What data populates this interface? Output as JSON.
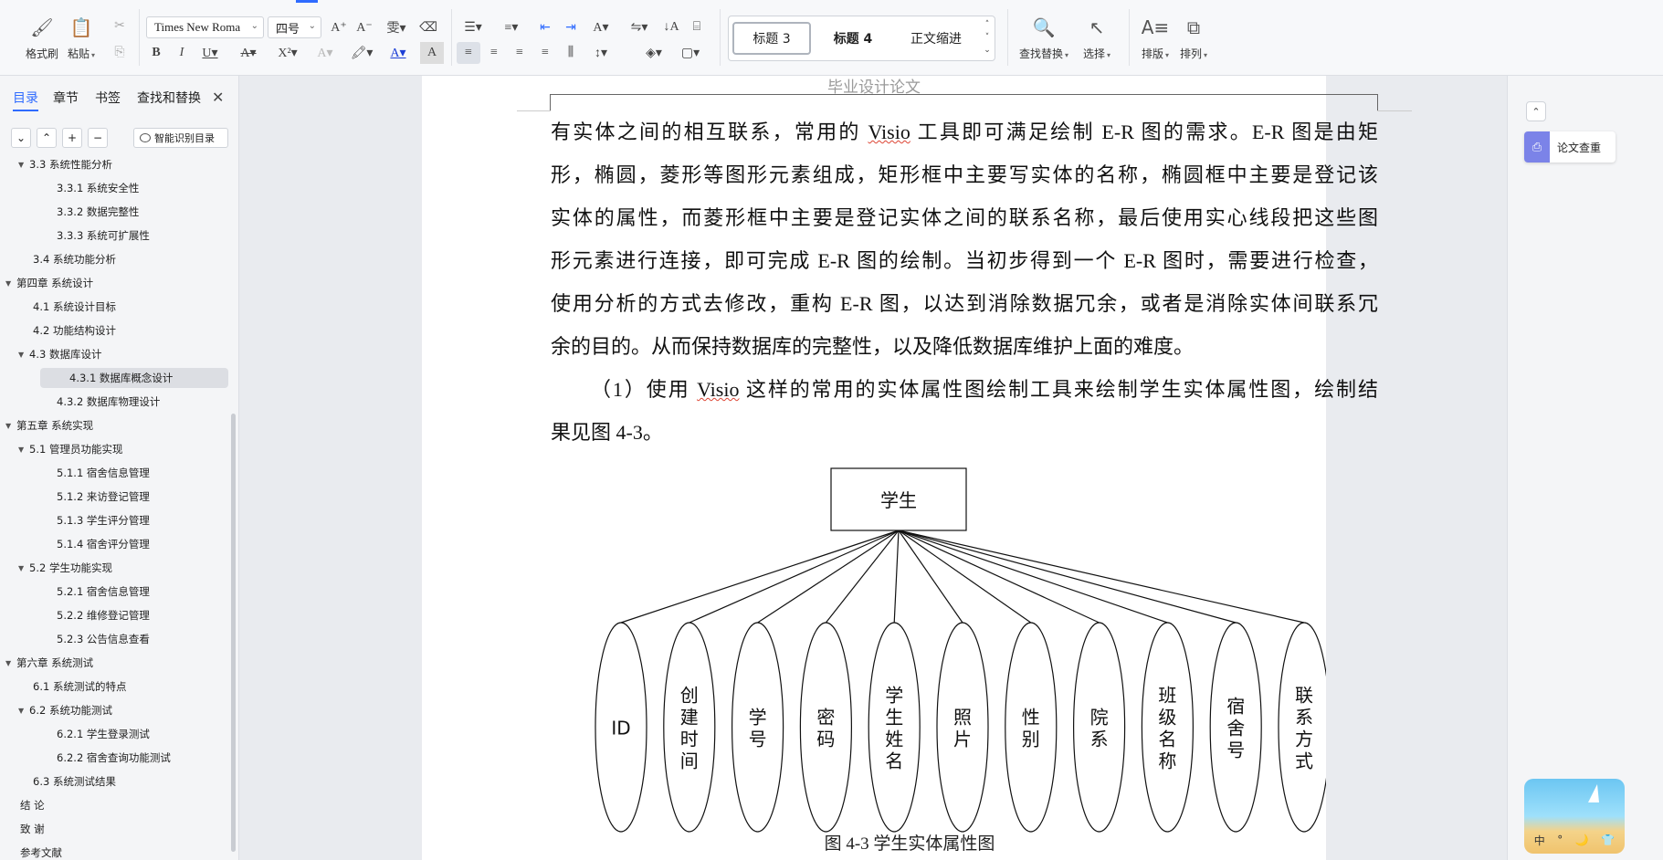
{
  "toolbar": {
    "format_painter": "格式刷",
    "paste": "粘贴",
    "font_name": "Times New Roma",
    "font_size": "四号",
    "styles": [
      "标题 3",
      "标题 4",
      "正文缩进"
    ],
    "find_replace": "查找替换",
    "select": "选择",
    "typeset": "排版",
    "arrange": "排列"
  },
  "nav": {
    "tabs": [
      "目录",
      "章节",
      "书签",
      "查找和替换"
    ],
    "smart_toc": "智能识别目录",
    "toc": [
      {
        "label": "3.3 系统性能分析",
        "level": 2,
        "collapsible": true
      },
      {
        "label": "3.3.1 系统安全性",
        "level": 3
      },
      {
        "label": "3.3.2 数据完整性",
        "level": 3
      },
      {
        "label": "3.3.3 系统可扩展性",
        "level": 3
      },
      {
        "label": "3.4 系统功能分析",
        "level": 2
      },
      {
        "label": "第四章  系统设计",
        "level": 1,
        "collapsible": true
      },
      {
        "label": "4.1  系统设计目标",
        "level": 2
      },
      {
        "label": "4.2 功能结构设计",
        "level": 2
      },
      {
        "label": "4.3 数据库设计",
        "level": 2,
        "collapsible": true
      },
      {
        "label": "4.3.1  数据库概念设计",
        "level": 3,
        "selected": true
      },
      {
        "label": "4.3.2  数据库物理设计",
        "level": 3
      },
      {
        "label": "第五章  系统实现",
        "level": 1,
        "collapsible": true
      },
      {
        "label": "5.1 管理员功能实现",
        "level": 2,
        "collapsible": true
      },
      {
        "label": "5.1.1  宿舍信息管理",
        "level": 3
      },
      {
        "label": "5.1.2  来访登记管理",
        "level": 3
      },
      {
        "label": "5.1.3  学生评分管理",
        "level": 3
      },
      {
        "label": "5.1.4  宿舍评分管理",
        "level": 3
      },
      {
        "label": "5.2 学生功能实现",
        "level": 2,
        "collapsible": true
      },
      {
        "label": "5.2.1  宿舍信息管理",
        "level": 3
      },
      {
        "label": "5.2.2  维修登记管理",
        "level": 3
      },
      {
        "label": "5.2.3  公告信息查看",
        "level": 3
      },
      {
        "label": "第六章  系统测试",
        "level": 1,
        "collapsible": true
      },
      {
        "label": "6.1 系统测试的特点",
        "level": 2
      },
      {
        "label": "6.2  系统功能测试",
        "level": 2,
        "collapsible": true
      },
      {
        "label": "6.2.1  学生登录测试",
        "level": 3
      },
      {
        "label": "6.2.2  宿舍查询功能测试",
        "level": 3
      },
      {
        "label": "6.3  系统测试结果",
        "level": 2
      },
      {
        "label": "结    论",
        "level": 1
      },
      {
        "label": "致    谢",
        "level": 1
      },
      {
        "label": "参考文献",
        "level": 1
      }
    ]
  },
  "document": {
    "header": "毕业设计论文",
    "lines": [
      [
        "有实体之间的相互联系，常用的 ",
        "Visio",
        " 工具即可满足绘制 E-R 图的需求。E-R 图是由矩"
      ],
      [
        "形，椭圆，菱形等图形元素组成，矩形框中主要写实体的名称，椭圆框中主要是登记该"
      ],
      [
        "实体的属性，而菱形框中主要是登记实体之间的联系名称，最后使用实心线段把这些图"
      ],
      [
        "形元素进行连接，即可完成 E-R 图的绘制。当初步得到一个 E-R 图时，需要进行检查，"
      ],
      [
        "使用分析的方式去修改，重构 E-R 图，以达到消除数据冗余，或者是消除实体间联系冗"
      ],
      [
        "余的目的。从而保持数据库的完整性，以及降低数据库维护上面的难度。"
      ],
      [
        "（1）使用 ",
        "Visio",
        " 这样的常用的实体属性图绘制工具来绘制学生实体属性图，绘制结"
      ],
      [
        "果见图 4-3。"
      ]
    ],
    "entity": "学生",
    "attributes": [
      "ID",
      "创建时间",
      "学号",
      "密码",
      "学生姓名",
      "照片",
      "性别",
      "院系",
      "班级名称",
      "宿舍号",
      "联系方式"
    ],
    "caption": "图 4-3  学生实体属性图"
  },
  "right": {
    "paper_check": "论文查重",
    "widget_labels": [
      "中",
      "°",
      "🌙",
      "👕"
    ]
  }
}
